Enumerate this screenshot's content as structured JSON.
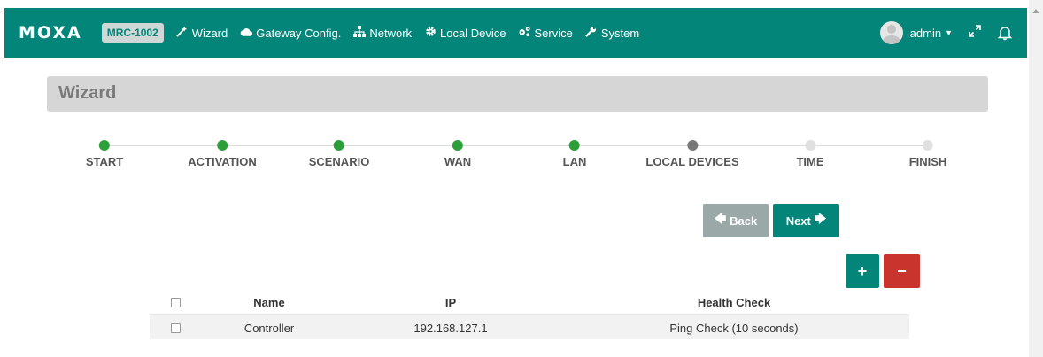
{
  "navbar": {
    "logo": "MOXA",
    "model": "MRC-1002",
    "items": [
      {
        "icon": "magic-wand-icon",
        "label": "Wizard"
      },
      {
        "icon": "cloud-icon",
        "label": "Gateway Config."
      },
      {
        "icon": "sitemap-icon",
        "label": "Network"
      },
      {
        "icon": "gear-icon",
        "label": "Local Device"
      },
      {
        "icon": "gears-icon",
        "label": "Service"
      },
      {
        "icon": "wrench-icon",
        "label": "System"
      }
    ],
    "user": "admin"
  },
  "page": {
    "title": "Wizard"
  },
  "stepper": {
    "steps": [
      {
        "label": "START",
        "status": "done"
      },
      {
        "label": "ACTIVATION",
        "status": "done"
      },
      {
        "label": "SCENARIO",
        "status": "done"
      },
      {
        "label": "WAN",
        "status": "done"
      },
      {
        "label": "LAN",
        "status": "done"
      },
      {
        "label": "LOCAL DEVICES",
        "status": "current"
      },
      {
        "label": "TIME",
        "status": "todo"
      },
      {
        "label": "FINISH",
        "status": "todo"
      }
    ]
  },
  "buttons": {
    "back": "Back",
    "next": "Next",
    "add": "+",
    "remove": "−"
  },
  "table": {
    "columns": [
      "Name",
      "IP",
      "Health Check"
    ],
    "rows": [
      {
        "name": "Controller",
        "ip": "192.168.127.1",
        "health_check": "Ping Check (10 seconds)"
      }
    ]
  },
  "colors": {
    "primary": "#04857a",
    "step_done": "#2d9f3a",
    "step_current": "#787878",
    "danger": "#c9342c"
  }
}
